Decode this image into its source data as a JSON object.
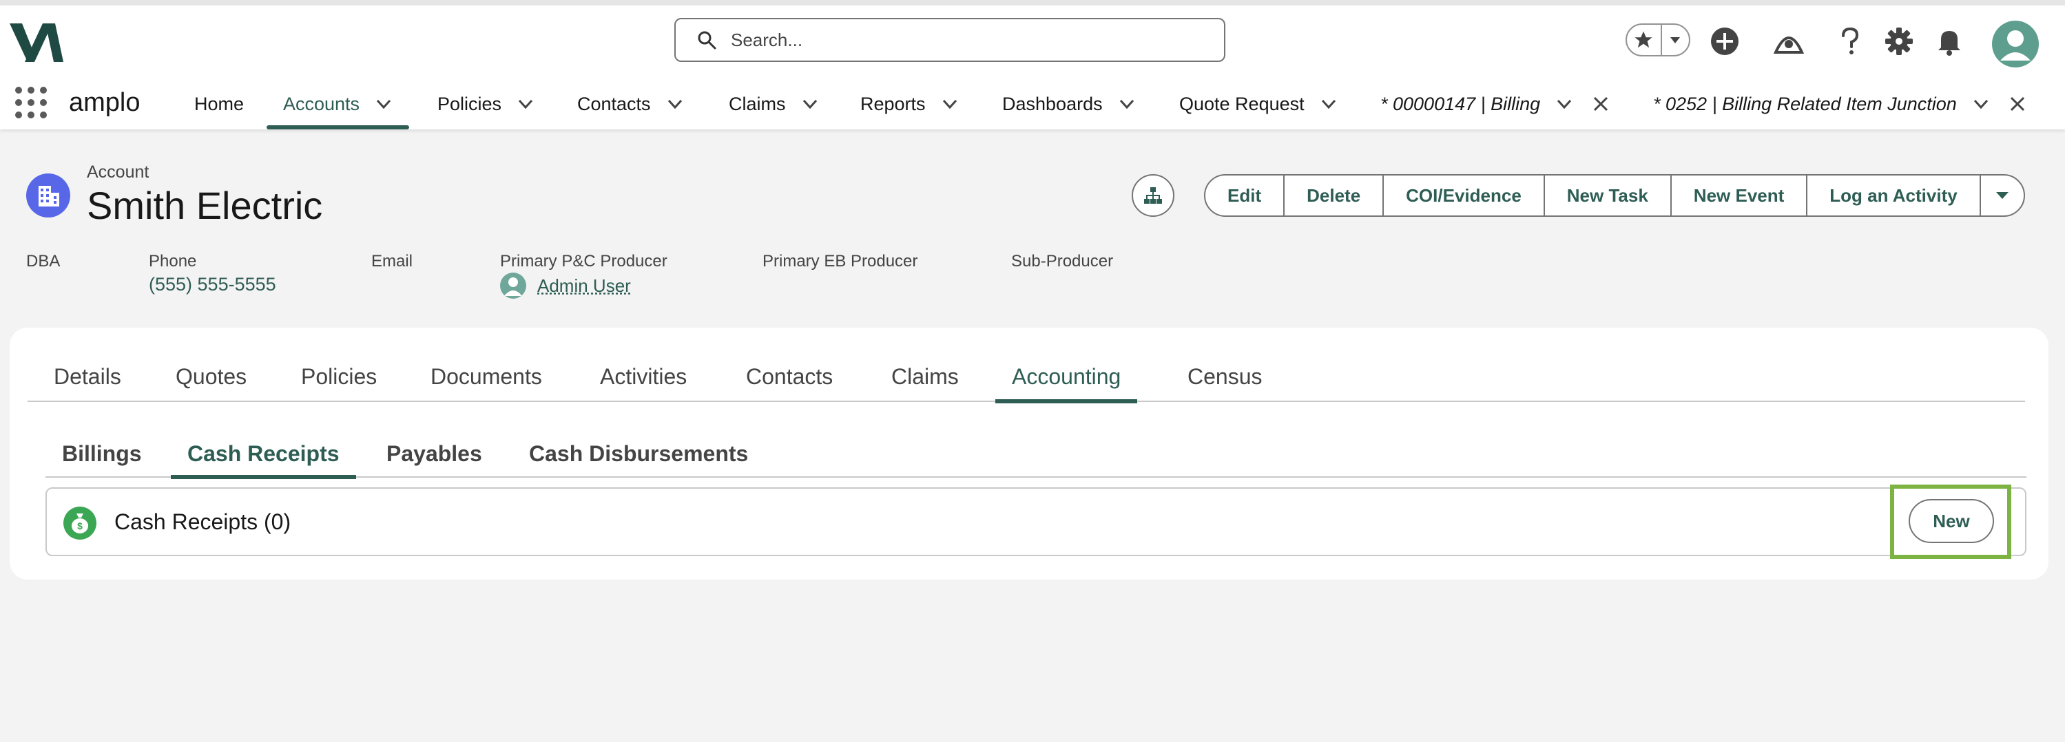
{
  "header": {
    "search_placeholder": "Search...",
    "icons": [
      "favorites-star-icon",
      "add-icon",
      "trailhead-icon",
      "help-icon",
      "setup-gear-icon",
      "notifications-bell-icon",
      "user-avatar-icon"
    ]
  },
  "nav": {
    "app_name": "amplo",
    "items": [
      {
        "label": "Home"
      },
      {
        "label": "Accounts"
      },
      {
        "label": "Policies"
      },
      {
        "label": "Contacts"
      },
      {
        "label": "Claims"
      },
      {
        "label": "Reports"
      },
      {
        "label": "Dashboards"
      },
      {
        "label": "Quote Request"
      }
    ],
    "active": "Accounts",
    "open_tabs": [
      {
        "label": "* 00000147 | Billing"
      },
      {
        "label": "* 0252 | Billing Related Item Junction"
      }
    ]
  },
  "record": {
    "type_label": "Account",
    "name": "Smith Electric",
    "actions": [
      "Edit",
      "Delete",
      "COI/Evidence",
      "New Task",
      "New Event",
      "Log an Activity"
    ],
    "highlights": [
      {
        "label": "DBA",
        "value": ""
      },
      {
        "label": "Phone",
        "value": "(555) 555-5555"
      },
      {
        "label": "Email",
        "value": ""
      },
      {
        "label": "Primary P&C Producer",
        "value": "Admin User"
      },
      {
        "label": "Primary EB Producer",
        "value": ""
      },
      {
        "label": "Sub-Producer",
        "value": ""
      }
    ]
  },
  "tabs": [
    "Details",
    "Quotes",
    "Policies",
    "Documents",
    "Activities",
    "Contacts",
    "Claims",
    "Accounting",
    "Census"
  ],
  "active_tab": "Accounting",
  "subtabs": [
    "Billings",
    "Cash Receipts",
    "Payables",
    "Cash Disbursements"
  ],
  "active_subtab": "Cash Receipts",
  "related_list": {
    "title": "Cash Receipts (0)",
    "new_label": "New"
  },
  "colors": {
    "brand": "#2e5d54",
    "record_icon": "#5867e8",
    "cash_icon": "#3ba755",
    "highlight": "#7cb342"
  }
}
